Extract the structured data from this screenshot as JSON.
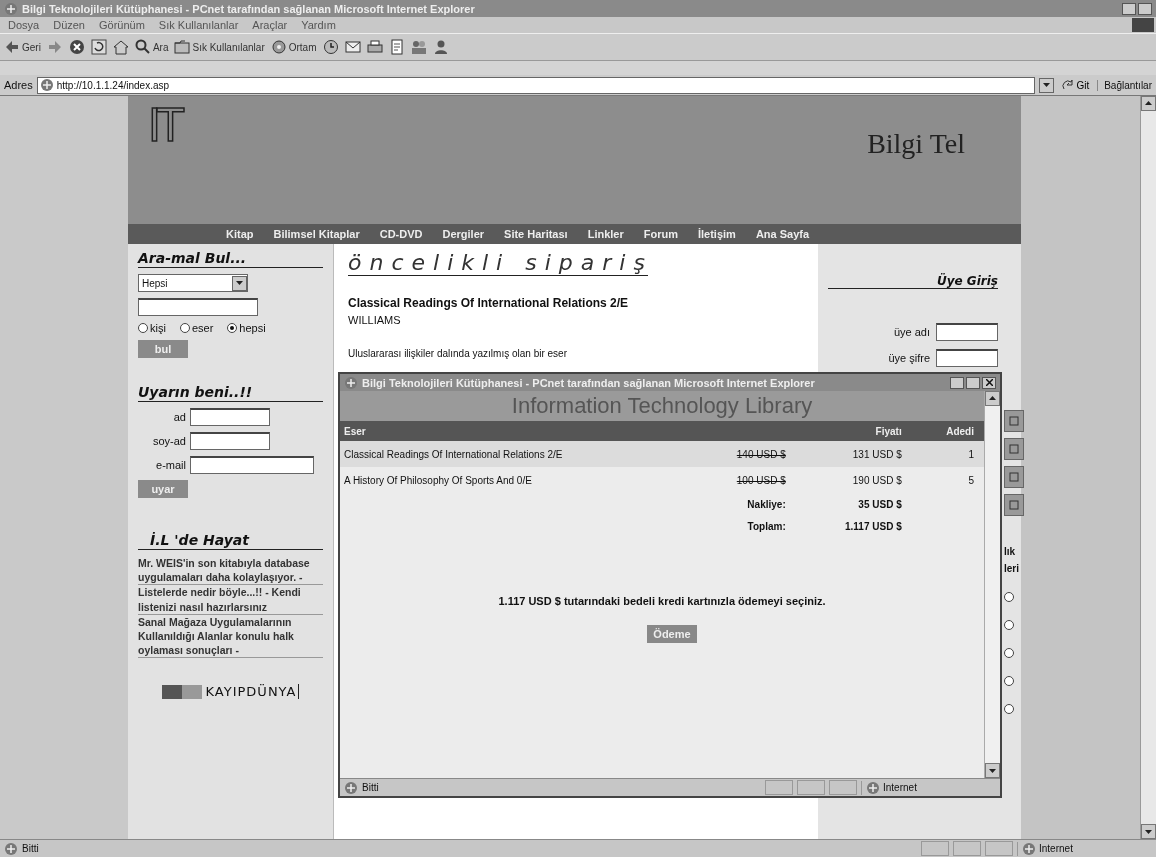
{
  "window": {
    "title": "Bilgi Teknolojileri Kütüphanesi - PCnet tarafından sağlanan Microsoft Internet Explorer"
  },
  "menu": [
    "Dosya",
    "Düzen",
    "Görünüm",
    "Sık Kullanılanlar",
    "Araçlar",
    "Yardım"
  ],
  "toolbar": [
    {
      "kind": "back",
      "label": "Geri"
    },
    {
      "kind": "forward"
    },
    {
      "kind": "stop"
    },
    {
      "kind": "refresh"
    },
    {
      "kind": "home"
    },
    {
      "kind": "search",
      "label": "Ara"
    },
    {
      "kind": "favorites",
      "label": "Sık Kullanılanlar"
    },
    {
      "kind": "media",
      "label": "Ortam"
    },
    {
      "kind": "history"
    },
    {
      "kind": "mail"
    },
    {
      "kind": "print"
    },
    {
      "kind": "edit"
    },
    {
      "kind": "discuss"
    },
    {
      "kind": "messenger"
    }
  ],
  "address": {
    "label": "Adres",
    "url": "http://10.1.1.24/index.asp",
    "go": "Git",
    "links": "Bağlantılar"
  },
  "site": {
    "logo": "IT",
    "brand": "Bilgi Tel",
    "nav": [
      "Kitap",
      "Bilimsel Kitaplar",
      "CD-DVD",
      "Dergiler",
      "Site Haritası",
      "Linkler",
      "Forum",
      "İletişim",
      "Ana Sayfa"
    ],
    "search": {
      "title": "Ara-mal Bul...",
      "category": "Hepsi",
      "radios": [
        {
          "label": "kişi",
          "selected": false
        },
        {
          "label": "eser",
          "selected": false
        },
        {
          "label": "hepsi",
          "selected": true
        }
      ],
      "button": "bul"
    },
    "alert": {
      "title": "Uyarın beni..!!",
      "fields": [
        "ad",
        "soy-ad",
        "e-mail"
      ],
      "button": "uyar"
    },
    "news": {
      "title": "İ.L 'de Hayat",
      "items": [
        "Mr. WEIS'in son kitabıyla database uygulamaları daha kolaylaşıyor. -",
        "Listelerde nedir böyle...!! - Kendi listenizi nasıl hazırlarsınız",
        "Sanal Mağaza Uygulamalarının Kullanıldığı Alanlar konulu halk oylaması sonuçları -"
      ]
    },
    "banner": "KAYIPDÜNYA",
    "featured": {
      "title": "öncelikli sipariş",
      "book": "Classical Readings Of International Relations 2/E",
      "author": "WILLIAMS",
      "description": "Uluslararası ilişkiler dalında yazılmış olan bir eser"
    },
    "login": {
      "title": "Üye Giriş",
      "fields": [
        "üye adı",
        "üye şifre"
      ]
    },
    "side_strip": {
      "labels": [
        "lık",
        "leri"
      ],
      "radios": [
        {
          "selected": false
        },
        {
          "selected": false
        },
        {
          "selected": false
        },
        {
          "selected": false
        },
        {
          "selected": false
        }
      ]
    }
  },
  "popup": {
    "title": "Bilgi Teknolojileri Kütüphanesi - PCnet tarafından sağlanan Microsoft Internet Explorer",
    "heading": "Information Technology Library",
    "columns": [
      "Eser",
      "Fiyatı",
      "Adedi"
    ],
    "rows": [
      {
        "title": "Classical Readings Of International Relations 2/E",
        "old_price": "140 USD $",
        "price": "131 USD $",
        "qty": "1"
      },
      {
        "title": "A History Of Philosophy Of Sports And 0/E",
        "old_price": "100 USD $",
        "price": "190 USD $",
        "qty": "5"
      }
    ],
    "totals": [
      {
        "label": "Nakliye:",
        "value": "35 USD $"
      },
      {
        "label": "Toplam:",
        "value": "1.117 USD $"
      }
    ],
    "message": "1.117 USD $ tutarındaki bedeli kredi kartınızla ödemeyi seçiniz.",
    "button": "Ödeme",
    "status": {
      "text": "Bitti",
      "zone": "Internet"
    }
  },
  "status_bar": {
    "text": "Bitti",
    "zone": "Internet"
  }
}
